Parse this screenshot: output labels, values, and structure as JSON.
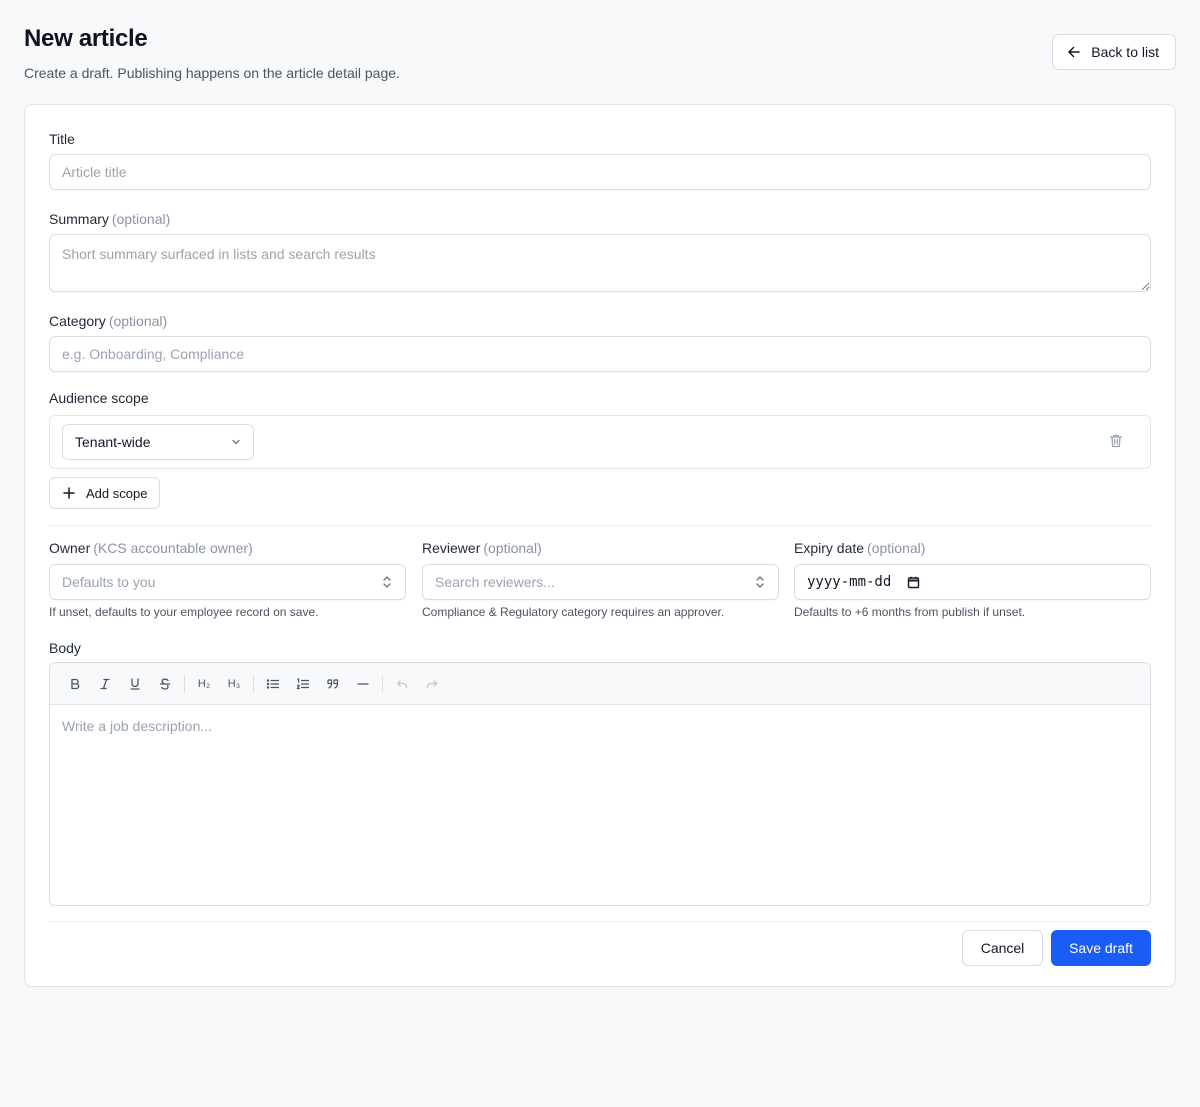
{
  "header": {
    "title": "New article",
    "subtitle": "Create a draft. Publishing happens on the article detail page.",
    "back_label": "Back to list"
  },
  "form": {
    "title": {
      "label": "Title",
      "placeholder": "Article title"
    },
    "summary": {
      "label": "Summary",
      "optional": "(optional)",
      "placeholder": "Short summary surfaced in lists and search results"
    },
    "category": {
      "label": "Category",
      "optional": "(optional)",
      "placeholder": "e.g. Onboarding, Compliance"
    },
    "audience": {
      "label": "Audience scope",
      "selected": "Tenant-wide",
      "add_label": "Add scope"
    },
    "owner": {
      "label": "Owner",
      "optional": "(KCS accountable owner)",
      "placeholder": "Defaults to you",
      "help": "If unset, defaults to your employee record on save."
    },
    "reviewer": {
      "label": "Reviewer",
      "optional": "(optional)",
      "placeholder": "Search reviewers...",
      "help": "Compliance & Regulatory category requires an approver."
    },
    "expiry": {
      "label": "Expiry date",
      "optional": "(optional)",
      "value": "yyyy-mm-dd",
      "help": "Defaults to +6 months from publish if unset."
    },
    "body": {
      "label": "Body",
      "placeholder": "Write a job description..."
    }
  },
  "toolbar": {
    "bold": "B",
    "italic": "I",
    "underline": "U",
    "strike": "S",
    "h2": "H₂",
    "h3": "H₃"
  },
  "actions": {
    "cancel_label": "Cancel",
    "save_label": "Save draft"
  },
  "colors": {
    "primary": "#1a5cf6",
    "background": "#f8f9fb"
  }
}
